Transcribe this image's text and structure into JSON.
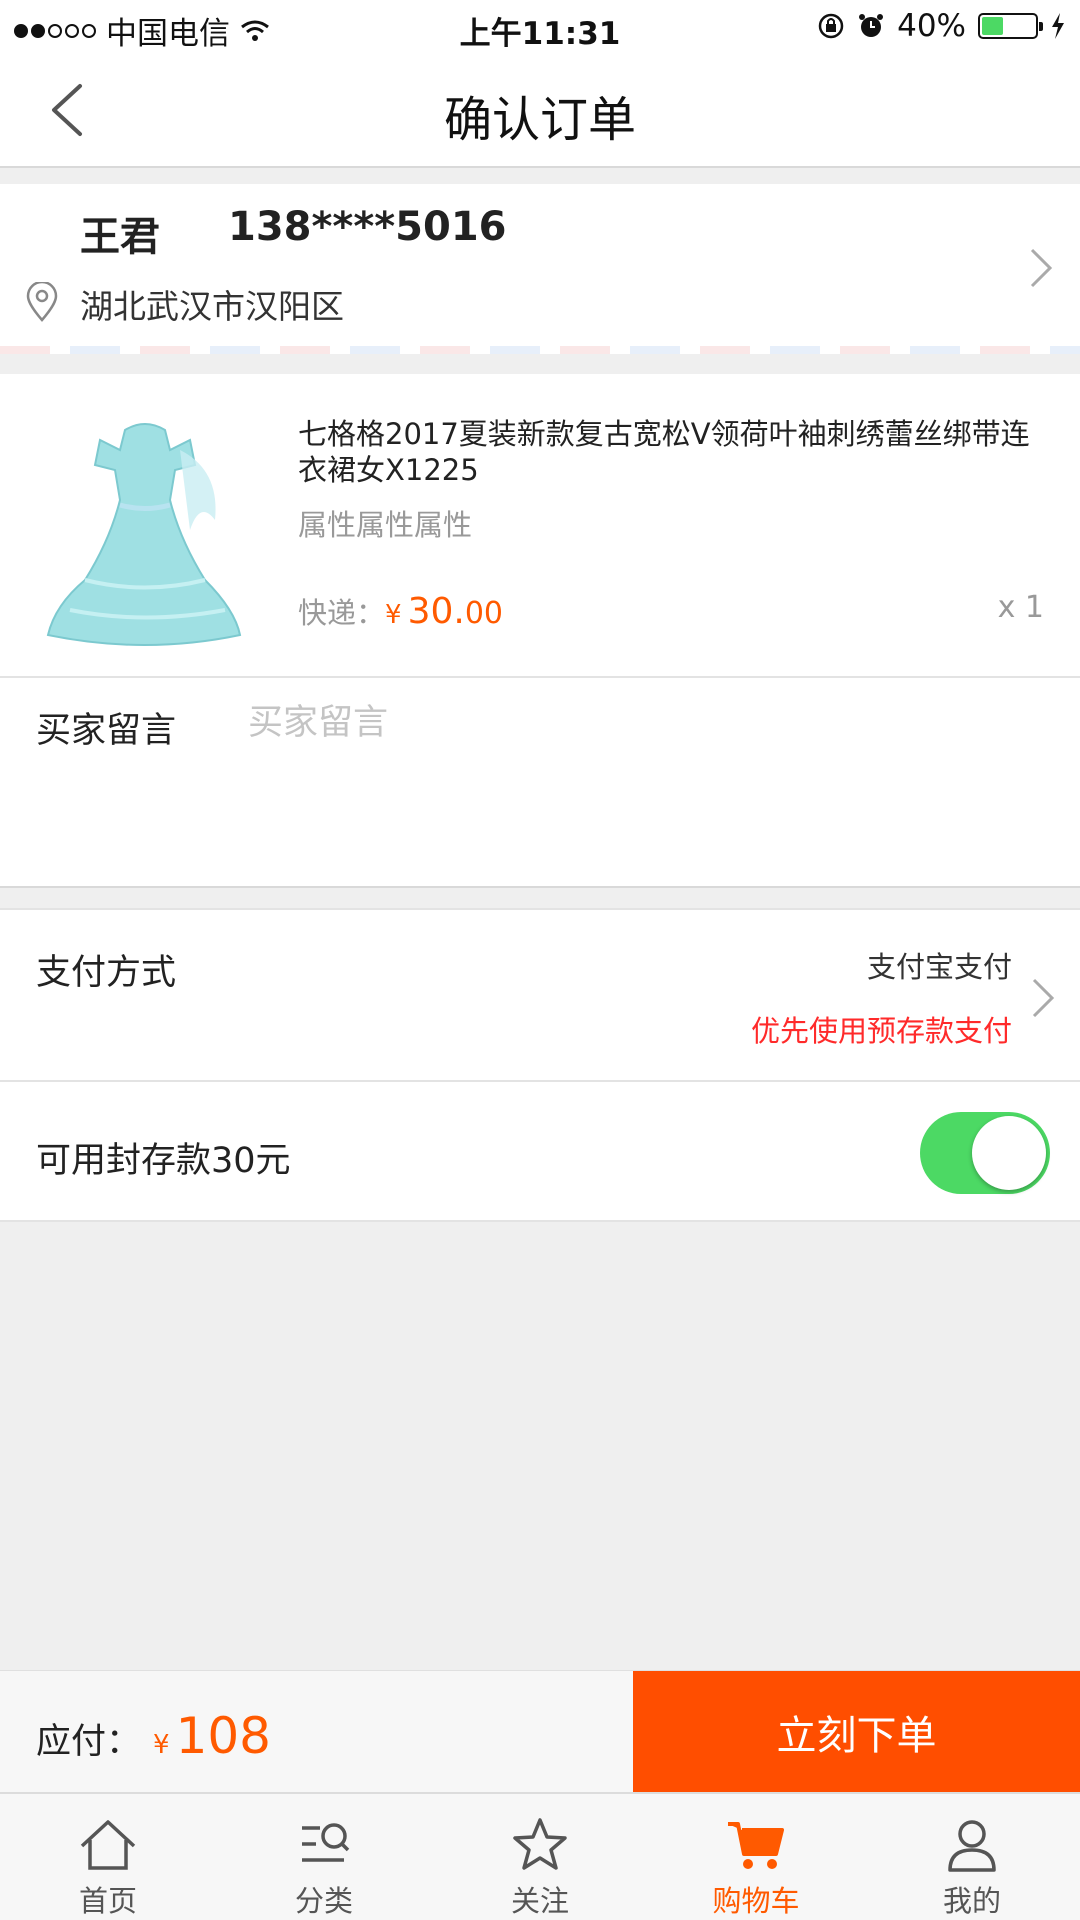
{
  "status_bar": {
    "carrier": "中国电信",
    "time": "上午11:31",
    "battery": "40%",
    "battery_level": 0.4
  },
  "navbar": {
    "title": "确认订单",
    "back_icon": "chevron-left-icon"
  },
  "address": {
    "name": "王君",
    "phone": "138****5016",
    "location": "湖北武汉市汉阳区"
  },
  "product": {
    "title": "七格格2017夏装新款复古宽松V领荷叶袖刺绣蕾丝绑带连衣裙女X1225",
    "attributes": "属性属性属性",
    "shipping_label": "快递：",
    "currency": "¥",
    "price_int": "30.",
    "price_dec": "00",
    "quantity": "x 1"
  },
  "buyer_note": {
    "label": "买家留言",
    "placeholder": "买家留言",
    "value": ""
  },
  "payment": {
    "label": "支付方式",
    "method": "支付宝支付",
    "tip": "优先使用预存款支付"
  },
  "deposit": {
    "label": "可用封存款30元",
    "enabled": true
  },
  "order_bar": {
    "due_label": "应付：",
    "currency": "¥",
    "amount": "108",
    "submit": "立刻下单"
  },
  "tabs": [
    {
      "label": "首页",
      "icon": "home-icon"
    },
    {
      "label": "分类",
      "icon": "category-search-icon"
    },
    {
      "label": "关注",
      "icon": "star-icon"
    },
    {
      "label": "购物车",
      "icon": "cart-icon",
      "active": true
    },
    {
      "label": "我的",
      "icon": "user-icon"
    }
  ],
  "colors": {
    "accent": "#ff5a00",
    "submit_bg": "#ff4e00",
    "tip_red": "#ff2a2a",
    "toggle_on": "#4cd964"
  }
}
